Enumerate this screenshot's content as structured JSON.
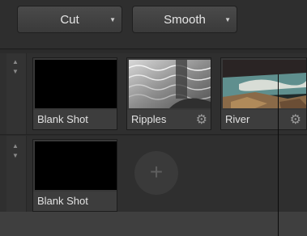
{
  "toolbar": {
    "transition_dropdown": {
      "label": "Cut"
    },
    "smoothing_dropdown": {
      "label": "Smooth"
    }
  },
  "tracks": [
    {
      "clips": [
        {
          "label": "Blank Shot",
          "thumbnail": "black"
        },
        {
          "label": "Ripples",
          "thumbnail": "water-ripples",
          "has_settings": true
        },
        {
          "label": "River",
          "thumbnail": "river-rocks",
          "has_settings": true
        }
      ]
    },
    {
      "clips": [
        {
          "label": "Blank Shot",
          "thumbnail": "black"
        }
      ],
      "add_button": "+"
    }
  ],
  "icons": {
    "caret": "▼",
    "gear": "⚙",
    "reorder_up": "▲",
    "reorder_down": "▼"
  }
}
